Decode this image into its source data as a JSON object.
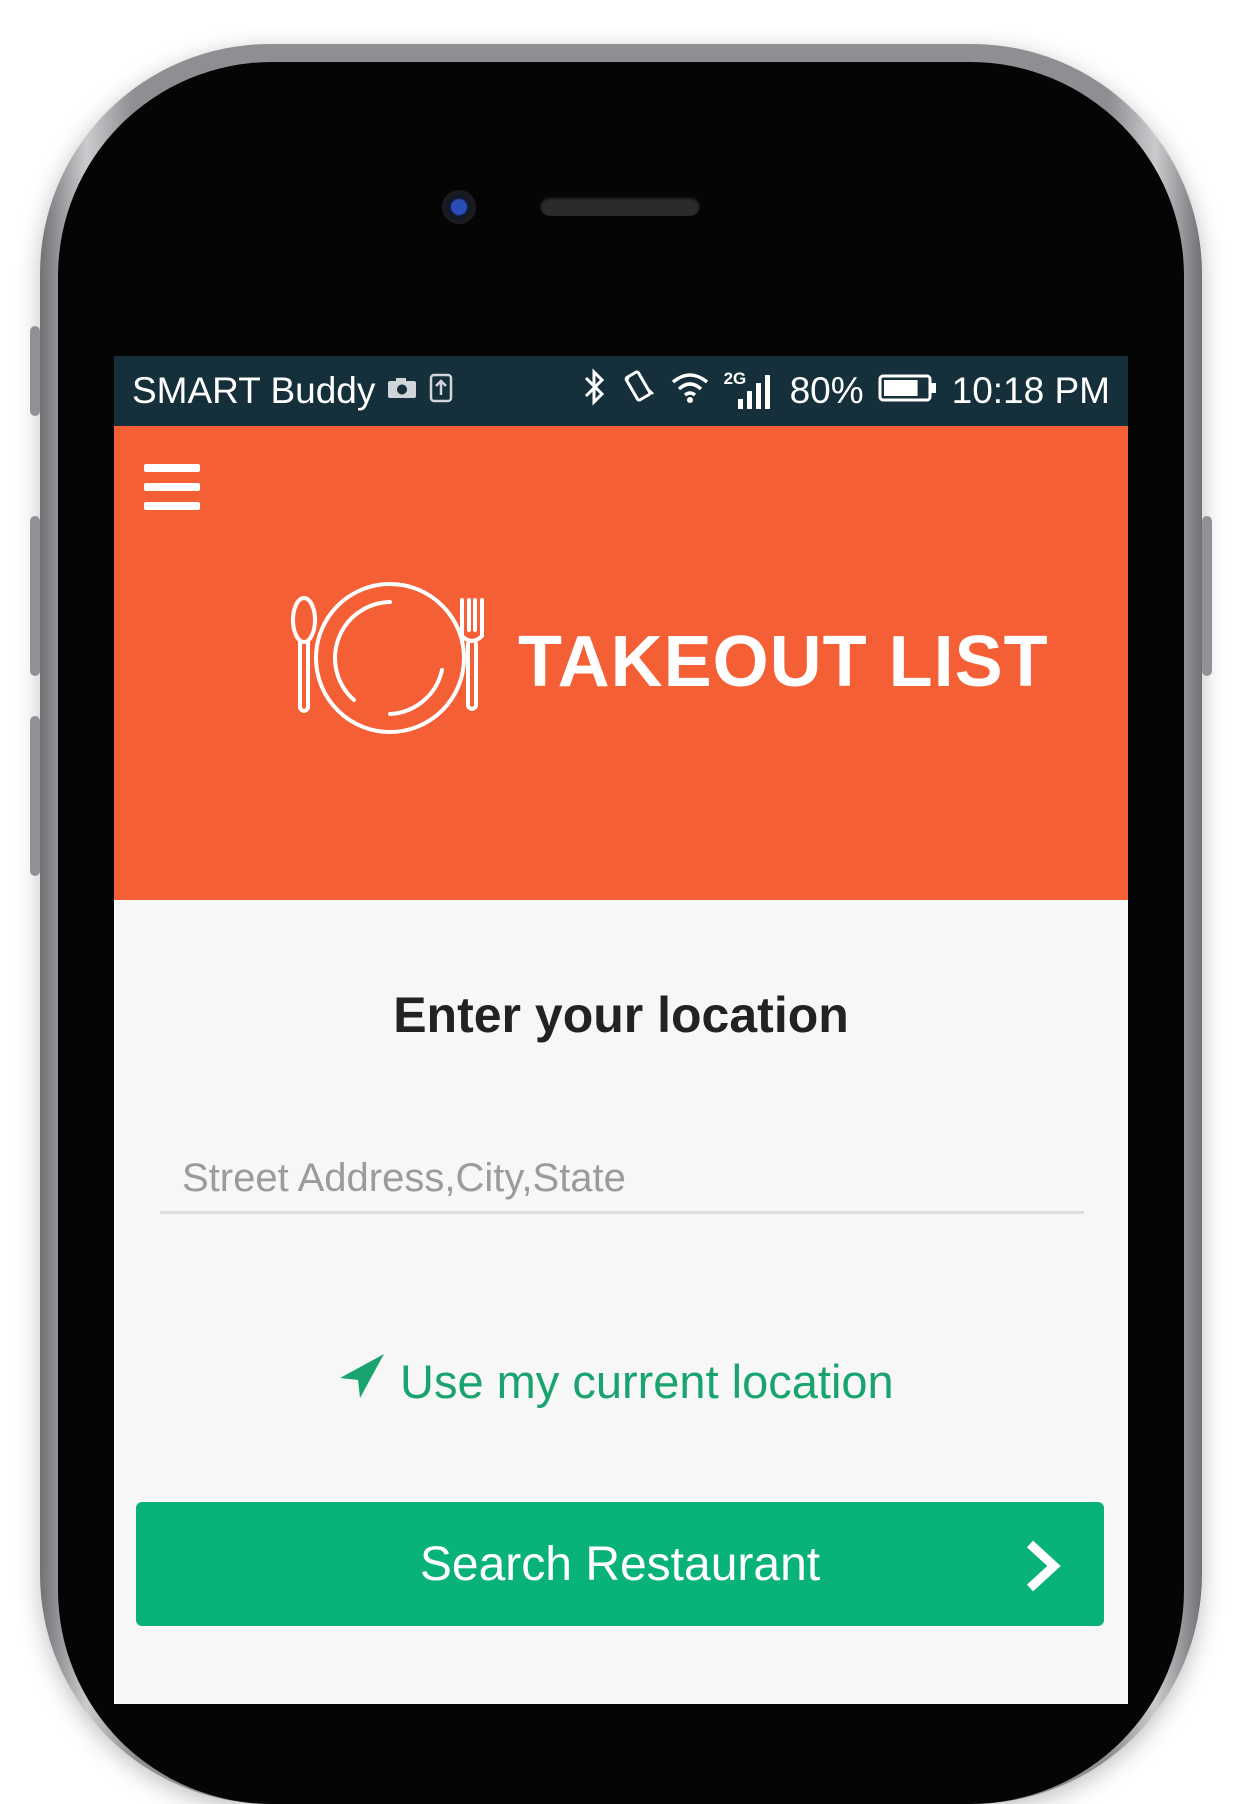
{
  "status_bar": {
    "carrier": "SMART Buddy",
    "network": "2G",
    "battery": "80%",
    "time": "10:18 PM",
    "battery_level": 0.8
  },
  "app": {
    "title": "TAKEOUT LIST",
    "logo_icon": "plate-utensils-icon",
    "menu_icon": "hamburger-menu-icon"
  },
  "main": {
    "heading": "Enter your location",
    "address_placeholder": "Street Address,City,State",
    "address_value": "",
    "use_location_label": "Use my current location",
    "use_location_icon": "navigation-arrow-icon",
    "search_button_label": "Search Restaurant",
    "search_button_icon": "chevron-right-icon"
  },
  "colors": {
    "header": "#f55f35",
    "status_bar": "#15303a",
    "accent_green": "#08b27a",
    "link_green": "#19a46f",
    "background": "#f7f7f7"
  }
}
